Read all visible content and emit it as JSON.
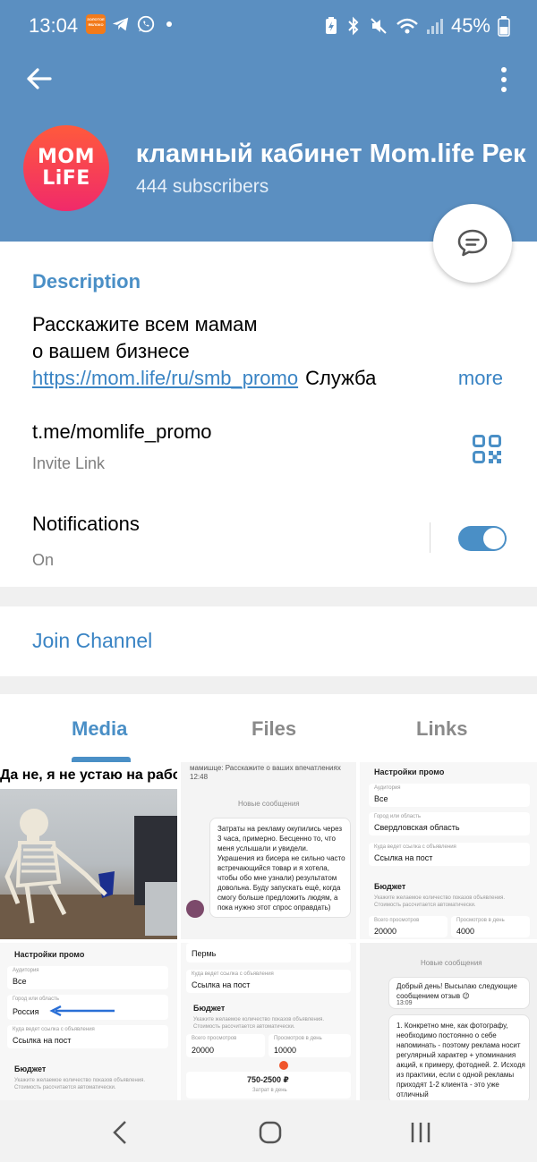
{
  "status_bar": {
    "time": "13:04",
    "app_badge_line1": "ЗОЛОТОЕ",
    "app_badge_line2": "ЯБЛОКО",
    "battery_text": "45%"
  },
  "channel": {
    "avatar_line1": "MOM",
    "avatar_line2": "LiFE",
    "title": "Рекламный кабинет Mom.life   Рек",
    "subscribers": "444 subscribers"
  },
  "description": {
    "heading": "Description",
    "line1": "Расскажите всем мамам",
    "line2": "о вашем бизнесе",
    "link": "https://mom.life/ru/smb_promo",
    "trailing": "Служба",
    "more": "more"
  },
  "invite": {
    "link": "t.me/momlife_promo",
    "label": "Invite Link"
  },
  "notifications": {
    "label": "Notifications",
    "state": "On",
    "enabled": true
  },
  "join_label": "Join Channel",
  "tabs": [
    {
      "label": "Media",
      "active": true
    },
    {
      "label": "Files",
      "active": false
    },
    {
      "label": "Links",
      "active": false
    }
  ],
  "media": {
    "meme_caption": "Да не, я не устаю на работе",
    "t2_top": "мамишце: Расскажите о ваших впечатлениях 12:48",
    "t2_new": "Новые сообщения",
    "t2_msg": "Затраты на рекламу окупились через 3 часа, примерно. Бесценно то, что меня услышали и увидели. Украшения из бисера не сильно часто встречающийся товар и я хотела, чтобы обо мне узнали) результатом довольна. Буду запускать ещё, когда смогу больше предложить людям, а пока нужно этот спрос оправдать)",
    "t2_time": "12:49",
    "promo_title": "Настройки промо",
    "audience_label": "Аудитория",
    "audience_value": "Все",
    "city_label": "Город или область",
    "city_value": "Свердловская область",
    "city_value_2": "Россия",
    "link_label": "Куда ведет ссылка с объявления",
    "link_value": "Ссылка на пост",
    "budget_title": "Бюджет",
    "budget_hint": "Укажите желаемое количество показов объявления. Стоимость рассчитается автоматически.",
    "views_total_label": "Всего просмотров",
    "views_total_value": "20000",
    "views_day_label": "Просмотров в день",
    "views_day_value": "4000",
    "t5_city": "Пермь",
    "t5_views_day": "10000",
    "t5_price": "750-2500 ₽",
    "t5_price_label": "Затрат в день",
    "t6_new": "Новые сообщения",
    "t6_greet": "Добрый день! Высылаю следующие сообщением отзыв 😉",
    "t6_time": "13:09",
    "t6_msg": "1. Конкретно мне, как фотографу, необходимо постоянно о себе напоминать - поэтому реклама носит регулярный характер + упоминания акций, к примеру, фотодней. 2. Исходя из практики, если с одной рекламы приходят 1-2 клиента - это уже отличный"
  }
}
